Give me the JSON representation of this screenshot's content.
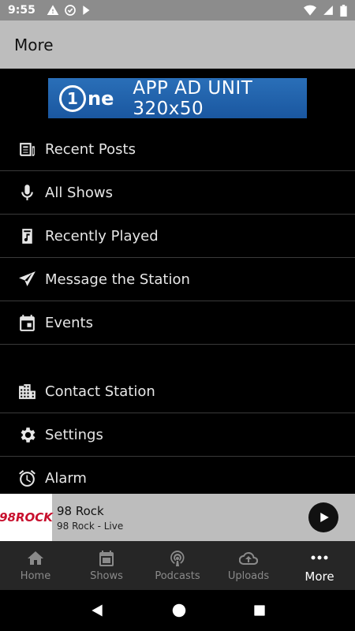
{
  "status": {
    "time": "9:55"
  },
  "appbar": {
    "title": "More"
  },
  "ad": {
    "logo_text": "ne",
    "logo_digit": "1",
    "text": "APP AD UNIT 320x50"
  },
  "menu": {
    "items": [
      {
        "label": "Recent Posts",
        "icon": "newspaper-icon"
      },
      {
        "label": "All Shows",
        "icon": "microphone-icon"
      },
      {
        "label": "Recently Played",
        "icon": "music-note-icon"
      },
      {
        "label": "Message the Station",
        "icon": "send-icon"
      },
      {
        "label": "Events",
        "icon": "calendar-icon"
      },
      {
        "label": "Contact Station",
        "icon": "building-icon"
      },
      {
        "label": "Settings",
        "icon": "gear-icon"
      },
      {
        "label": "Alarm",
        "icon": "alarm-icon"
      }
    ]
  },
  "player": {
    "logo": "98ROCK",
    "station": "98 Rock",
    "subtitle": "98 Rock - Live"
  },
  "nav": {
    "tabs": [
      {
        "label": "Home"
      },
      {
        "label": "Shows"
      },
      {
        "label": "Podcasts"
      },
      {
        "label": "Uploads"
      },
      {
        "label": "More"
      }
    ]
  },
  "colors": {
    "appbar": "#bdbdbd",
    "background": "#000000",
    "ad": "#1a57a0",
    "nav": "#262626"
  }
}
